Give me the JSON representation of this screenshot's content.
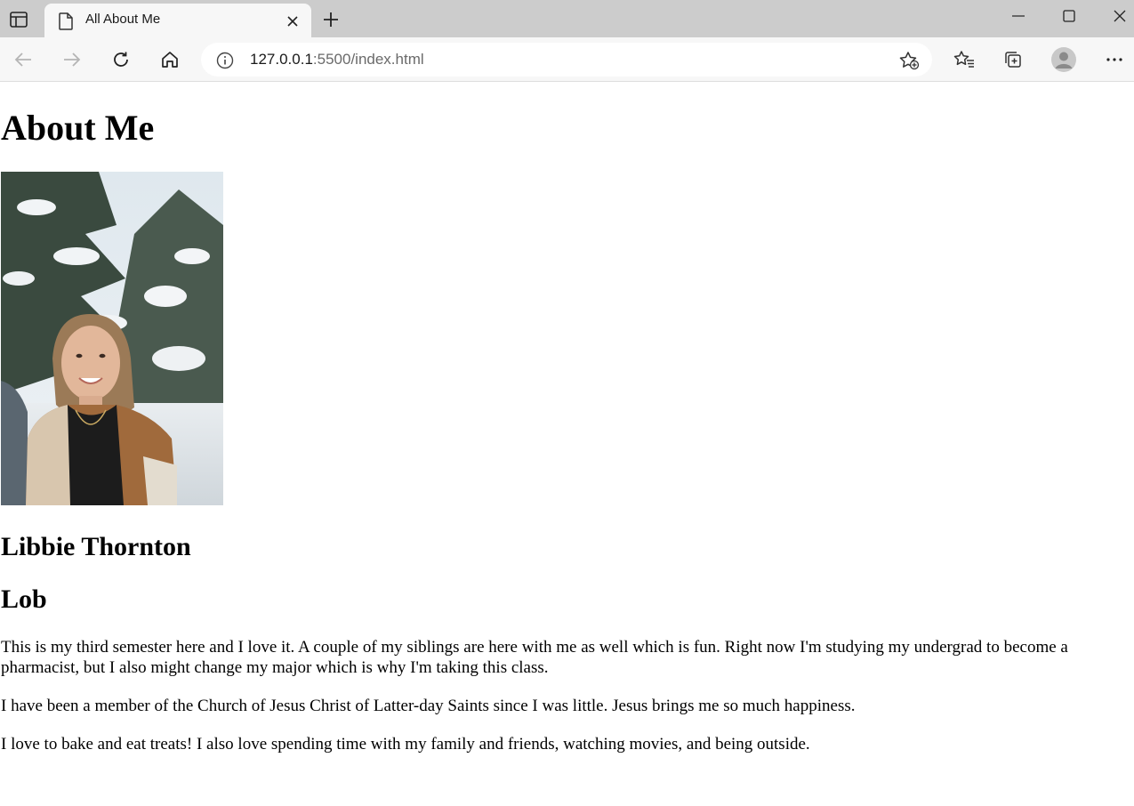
{
  "browser": {
    "tab_title": "All About Me",
    "url_host": "127.0.0.1",
    "url_path": ":5500/index.html",
    "icons": {
      "tab_actions": "tab-actions-icon",
      "favicon": "page-icon",
      "tab_close": "close-icon",
      "new_tab": "plus-icon",
      "minimize": "minimize-icon",
      "maximize": "maximize-icon",
      "close_window": "close-icon",
      "back": "back-arrow-icon",
      "forward": "forward-arrow-icon",
      "refresh": "refresh-icon",
      "home": "home-icon",
      "site_info": "info-icon",
      "add_favorite": "star-plus-icon",
      "favorites": "favorites-icon",
      "collections": "collections-icon",
      "profile": "profile-avatar-icon",
      "menu": "more-icon"
    }
  },
  "page": {
    "title": "About Me",
    "photo_alt": "profile-photo",
    "name": "Libbie Thornton",
    "nickname": "Lob",
    "paragraphs": [
      "This is my third semester here and I love it. A couple of my siblings are here with me as well which is fun. Right now I'm studying my undergrad to become a pharmacist, but I also might change my major which is why I'm taking this class.",
      "I have been a member of the Church of Jesus Christ of Latter-day Saints since I was little. Jesus brings me so much happiness.",
      "I love to bake and eat treats! I also love spending time with my family and friends, watching movies, and being outside."
    ]
  },
  "colors": {
    "tabstrip": "#cccccc",
    "toolbar": "#f7f7f7",
    "page_background": "#ffffff",
    "text": "#000000"
  }
}
